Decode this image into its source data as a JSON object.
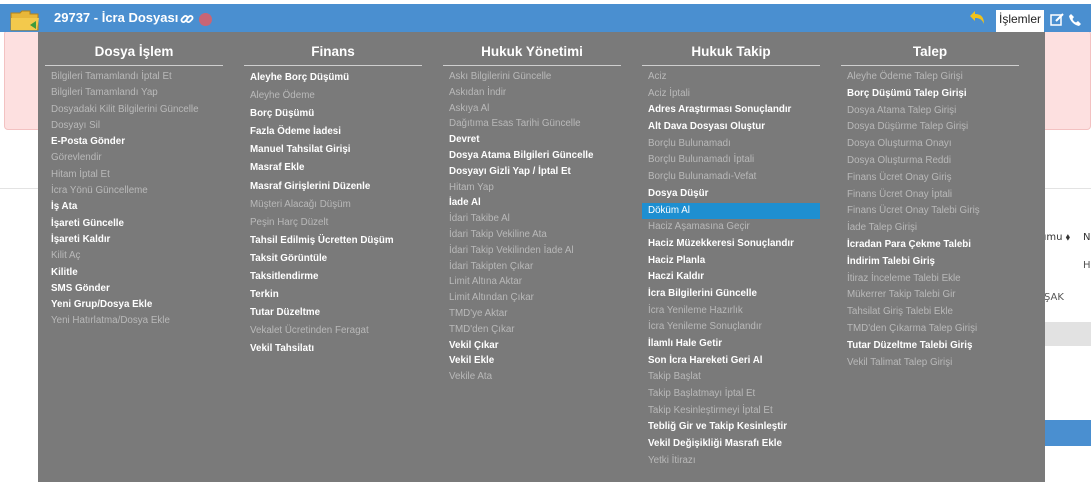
{
  "header": {
    "file_title": "29737 - İcra Dosyası",
    "ops_label": "İşlemler",
    "brand_color": "#4a8fd0",
    "status_dot_color": "#c86575"
  },
  "background": {
    "col_head_1": "umu ⬧",
    "col_head_2": "N",
    "cell_1": "H",
    "cell_2": "ŞAK"
  },
  "menu": {
    "selected_color": "#1e8fd1",
    "columns": [
      {
        "title": "Dosya İşlem",
        "items": [
          {
            "label": "Bilgileri Tamamlandı İptal Et",
            "enabled": false
          },
          {
            "label": "Bilgileri Tamamlandı Yap",
            "enabled": false
          },
          {
            "label": "Dosyadaki Kilit Bilgilerini Güncelle",
            "enabled": false
          },
          {
            "label": "Dosyayı Sil",
            "enabled": false
          },
          {
            "label": "E-Posta Gönder",
            "enabled": true
          },
          {
            "label": "Görevlendir",
            "enabled": false
          },
          {
            "label": "Hitam İptal Et",
            "enabled": false
          },
          {
            "label": "İcra Yönü Güncelleme",
            "enabled": false
          },
          {
            "label": "İş Ata",
            "enabled": true
          },
          {
            "label": "İşareti Güncelle",
            "enabled": true
          },
          {
            "label": "İşareti Kaldır",
            "enabled": true
          },
          {
            "label": "Kilit Aç",
            "enabled": false
          },
          {
            "label": "Kilitle",
            "enabled": true
          },
          {
            "label": "SMS Gönder",
            "enabled": true
          },
          {
            "label": "Yeni Grup/Dosya Ekle",
            "enabled": true
          },
          {
            "label": "Yeni Hatırlatma/Dosya Ekle",
            "enabled": false
          }
        ]
      },
      {
        "title": "Finans",
        "items": [
          {
            "label": "Aleyhe Borç Düşümü",
            "enabled": true
          },
          {
            "label": "Aleyhe Ödeme",
            "enabled": false
          },
          {
            "label": "Borç Düşümü",
            "enabled": true
          },
          {
            "label": "Fazla Ödeme İadesi",
            "enabled": true
          },
          {
            "label": "Manuel Tahsilat Girişi",
            "enabled": true
          },
          {
            "label": "Masraf Ekle",
            "enabled": true
          },
          {
            "label": "Masraf Girişlerini Düzenle",
            "enabled": true
          },
          {
            "label": "Müşteri Alacağı Düşüm",
            "enabled": false
          },
          {
            "label": "Peşin Harç Düzelt",
            "enabled": false
          },
          {
            "label": "Tahsil Edilmiş Ücretten Düşüm",
            "enabled": true
          },
          {
            "label": "Taksit Görüntüle",
            "enabled": true
          },
          {
            "label": "Taksitlendirme",
            "enabled": true
          },
          {
            "label": "Terkin",
            "enabled": true
          },
          {
            "label": "Tutar Düzeltme",
            "enabled": true
          },
          {
            "label": "Vekalet Ücretinden Feragat",
            "enabled": false
          },
          {
            "label": "Vekil Tahsilatı",
            "enabled": true
          }
        ]
      },
      {
        "title": "Hukuk Yönetimi",
        "items": [
          {
            "label": "Askı Bilgilerini Güncelle",
            "enabled": false
          },
          {
            "label": "Askıdan İndir",
            "enabled": false
          },
          {
            "label": "Askıya Al",
            "enabled": false
          },
          {
            "label": "Dağıtıma Esas Tarihi Güncelle",
            "enabled": false
          },
          {
            "label": "Devret",
            "enabled": true
          },
          {
            "label": "Dosya Atama Bilgileri Güncelle",
            "enabled": true
          },
          {
            "label": "Dosyayı Gizli Yap / İptal Et",
            "enabled": true
          },
          {
            "label": "Hitam Yap",
            "enabled": false
          },
          {
            "label": "İade Al",
            "enabled": true
          },
          {
            "label": "İdari Takibe Al",
            "enabled": false
          },
          {
            "label": "İdari Takip Vekiline Ata",
            "enabled": false
          },
          {
            "label": "İdari Takip Vekilinden İade Al",
            "enabled": false
          },
          {
            "label": "İdari Takipten Çıkar",
            "enabled": false
          },
          {
            "label": "Limit Altına Aktar",
            "enabled": false
          },
          {
            "label": "Limit Altından Çıkar",
            "enabled": false
          },
          {
            "label": "TMD'ye Aktar",
            "enabled": false
          },
          {
            "label": "TMD'den Çıkar",
            "enabled": false
          },
          {
            "label": "Vekil Çıkar",
            "enabled": true
          },
          {
            "label": "Vekil Ekle",
            "enabled": true
          },
          {
            "label": "Vekile Ata",
            "enabled": false
          }
        ]
      },
      {
        "title": "Hukuk Takip",
        "items": [
          {
            "label": "Aciz",
            "enabled": false
          },
          {
            "label": "Aciz İptali",
            "enabled": false
          },
          {
            "label": "Adres Araştırması Sonuçlandır",
            "enabled": true
          },
          {
            "label": "Alt Dava Dosyası Oluştur",
            "enabled": true
          },
          {
            "label": "Borçlu Bulunamadı",
            "enabled": false
          },
          {
            "label": "Borçlu Bulunamadı İptali",
            "enabled": false
          },
          {
            "label": "Borçlu Bulunamadı-Vefat",
            "enabled": false
          },
          {
            "label": "Dosya Düşür",
            "enabled": true
          },
          {
            "label": "Döküm Al",
            "enabled": true,
            "selected": true
          },
          {
            "label": "Haciz Aşamasına Geçir",
            "enabled": false
          },
          {
            "label": "Haciz Müzekkeresi Sonuçlandır",
            "enabled": true
          },
          {
            "label": "Haciz Planla",
            "enabled": true
          },
          {
            "label": "Haczi Kaldır",
            "enabled": true
          },
          {
            "label": "İcra Bilgilerini Güncelle",
            "enabled": true
          },
          {
            "label": "İcra Yenileme Hazırlık",
            "enabled": false
          },
          {
            "label": "İcra Yenileme Sonuçlandır",
            "enabled": false
          },
          {
            "label": "İlamlı Hale Getir",
            "enabled": true
          },
          {
            "label": "Son İcra Hareketi Geri Al",
            "enabled": true
          },
          {
            "label": "Takip Başlat",
            "enabled": false
          },
          {
            "label": "Takip Başlatmayı İptal Et",
            "enabled": false
          },
          {
            "label": "Takip Kesinleştirmeyi İptal Et",
            "enabled": false
          },
          {
            "label": "Tebliğ Gir ve Takip Kesinleştir",
            "enabled": true
          },
          {
            "label": "Vekil Değişikliği Masrafı Ekle",
            "enabled": true
          },
          {
            "label": "Yetki İtirazı",
            "enabled": false
          }
        ]
      },
      {
        "title": "Talep",
        "items": [
          {
            "label": "Aleyhe Ödeme Talep Girişi",
            "enabled": false
          },
          {
            "label": "Borç Düşümü Talep Girişi",
            "enabled": true
          },
          {
            "label": "Dosya Atama Talep Girişi",
            "enabled": false
          },
          {
            "label": "Dosya Düşürme Talep Girişi",
            "enabled": false
          },
          {
            "label": "Dosya Oluşturma Onayı",
            "enabled": false
          },
          {
            "label": "Dosya Oluşturma Reddi",
            "enabled": false
          },
          {
            "label": "Finans Ücret Onay Giriş",
            "enabled": false
          },
          {
            "label": "Finans Ücret Onay İptali",
            "enabled": false
          },
          {
            "label": "Finans Ücret Onay Talebi Giriş",
            "enabled": false
          },
          {
            "label": "İade Talep Girişi",
            "enabled": false
          },
          {
            "label": "İcradan Para Çekme Talebi",
            "enabled": true
          },
          {
            "label": "İndirim Talebi Giriş",
            "enabled": true
          },
          {
            "label": "İtiraz İnceleme Talebi Ekle",
            "enabled": false
          },
          {
            "label": "Mükerrer Takip Talebi Gir",
            "enabled": false
          },
          {
            "label": "Tahsilat Giriş Talebi Ekle",
            "enabled": false
          },
          {
            "label": "TMD'den Çıkarma Talep Girişi",
            "enabled": false
          },
          {
            "label": "Tutar Düzeltme Talebi Giriş",
            "enabled": true
          },
          {
            "label": "Vekil Talimat Talep Girişi",
            "enabled": false
          }
        ]
      }
    ]
  }
}
